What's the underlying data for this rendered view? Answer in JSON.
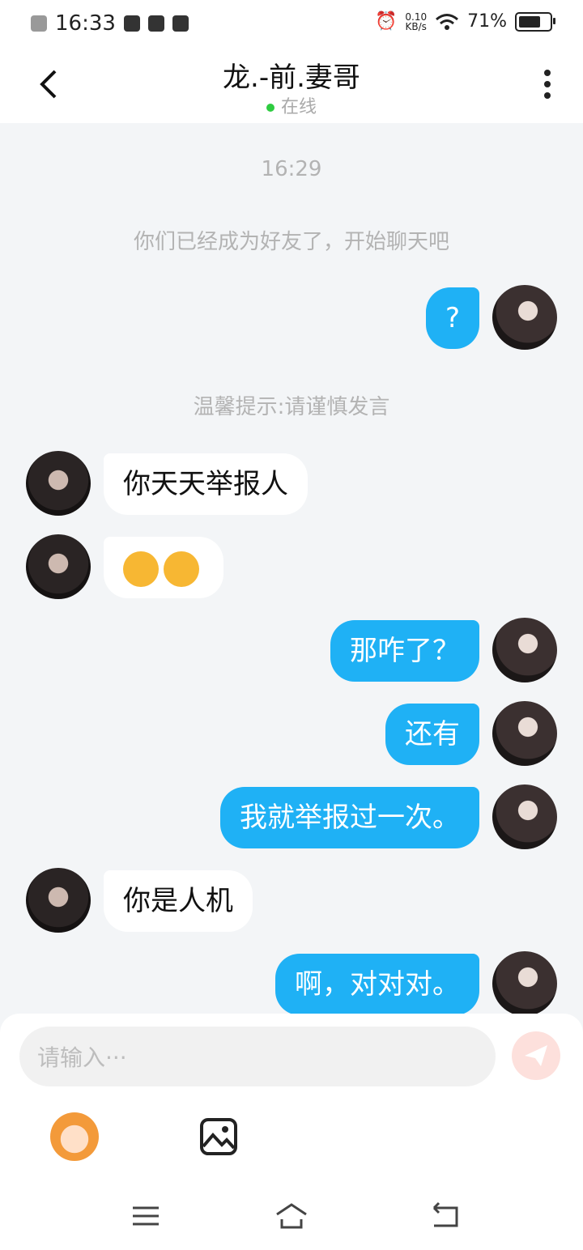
{
  "status_bar": {
    "time": "16:33",
    "speed_value": "0.10",
    "speed_unit": "KB/s",
    "battery": "71%"
  },
  "header": {
    "title": "龙.-前.妻哥",
    "status": "在线"
  },
  "chat": {
    "timestamp": "16:29",
    "friend_notice": "你们已经成为好友了，开始聊天吧",
    "tip": "温馨提示:请谨慎发言",
    "messages": [
      {
        "from": "me",
        "text": "?"
      },
      {
        "from": "other",
        "text": "你天天举报人"
      },
      {
        "from": "other",
        "text": ""
      },
      {
        "from": "me",
        "text": "那咋了？"
      },
      {
        "from": "me",
        "text": "还有"
      },
      {
        "from": "me",
        "text": "我就举报过一次。"
      },
      {
        "from": "other",
        "text": "你是人机"
      },
      {
        "from": "me",
        "text": "啊，对对对。"
      }
    ]
  },
  "composer": {
    "placeholder": "请输入···"
  },
  "icons": [
    "back-arrow-icon",
    "more-icon",
    "sweat-emoji-icon",
    "send-icon",
    "mascot-icon",
    "image-icon",
    "menu-icon",
    "home-icon",
    "back-icon"
  ],
  "colors": {
    "bubble_me": "#1fb1f5",
    "bubble_other": "#ffffff",
    "online_dot": "#2ecc40",
    "send_button": "#fde0dc"
  }
}
